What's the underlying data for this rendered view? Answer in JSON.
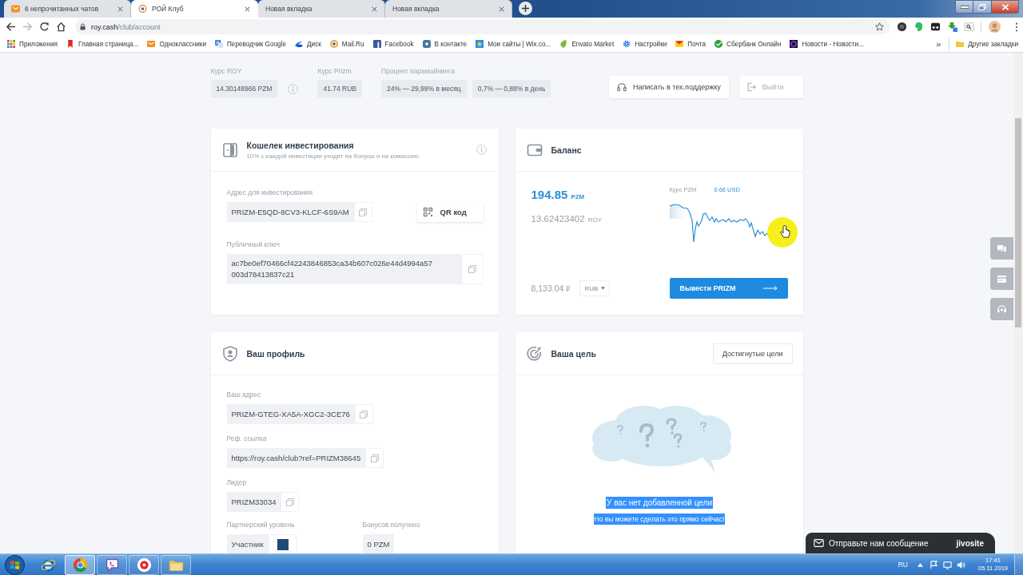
{
  "browser": {
    "tabs": [
      {
        "title": "6 непрочитанных чатов",
        "kind": "mail",
        "selected": false
      },
      {
        "title": "РОЙ Клуб",
        "kind": "site",
        "selected": true
      },
      {
        "title": "Новая вкладка",
        "kind": "blank",
        "selected": false
      },
      {
        "title": "Новая вкладка",
        "kind": "blank",
        "selected": false
      }
    ],
    "address": {
      "host": "roy.cash",
      "path": "/club/account"
    },
    "bookmarks": [
      {
        "label": "Приложения",
        "kind": "apps"
      },
      {
        "label": "Главная страница...",
        "kind": "stroke"
      },
      {
        "label": "Одноклассники",
        "kind": "envelope"
      },
      {
        "label": "Переводчик Google",
        "kind": "translate"
      },
      {
        "label": "Диск",
        "kind": "swoosh"
      },
      {
        "label": "Mail.Ru",
        "kind": "ring"
      },
      {
        "label": "Facebook",
        "kind": "square"
      },
      {
        "label": "В контакте",
        "kind": "rounded"
      },
      {
        "label": "Мои сайты | Wix.co...",
        "kind": "star"
      },
      {
        "label": "Envato Market",
        "kind": "leaf"
      },
      {
        "label": "Настройки",
        "kind": "gear"
      },
      {
        "label": "Почта",
        "kind": "mail"
      },
      {
        "label": "Сбербанк Онлайн",
        "kind": "check"
      },
      {
        "label": "Новости - Новости...",
        "kind": "orb"
      }
    ],
    "more": "»",
    "other_bookmarks": "Другие закладки"
  },
  "rates": [
    {
      "label": "Курс ROY",
      "values": [
        "14.30148966 PZM"
      ],
      "info": true
    },
    {
      "label": "Курс Prizm",
      "values": [
        "41.74 RUB"
      ],
      "info": false
    },
    {
      "label": "Процент парамайнинга",
      "values": [
        "24% — 29,99% в месяц",
        "0,7% — 0,88% в день"
      ],
      "info": false
    }
  ],
  "support_button": "Написать в тех.поддержку",
  "logout_button": "Выйти",
  "wallet": {
    "title": "Кошелек инвестирования",
    "subtitle": "10% с каждой инвестиции уходят на бонусы и на комиссию",
    "address_label": "Адрес для инвестирования",
    "address": "PRIZM-E5QD-8CV3-KLCF-6S9AM",
    "qr_button": "QR код",
    "key_label": "Публичный ключ",
    "public_key": "ac7be0ef70466cf42243846853ca34b607c026e44d4994a57003d78413837c21"
  },
  "balance": {
    "title": "Баланс",
    "pzm_amount": "194.85",
    "pzm_unit": "PZM",
    "roy_amount": "13.62423402",
    "roy_unit": "ROY",
    "rate_label": "Курс PZM",
    "rate_value": "0.66 USD",
    "fiat_amount": "8,133.04",
    "fiat_sign": "₽",
    "currency": "RUB",
    "withdraw_button": "Вывести PRIZM"
  },
  "profile": {
    "title": "Ваш профиль",
    "fields": [
      {
        "label": "Ваш адрес",
        "value": "PRIZM-GTEG-XA5A-XGC2-3CE76"
      },
      {
        "label": "Реф. ссылка",
        "value": "https://roy.cash/club?ref=PRIZM38645"
      },
      {
        "label": "Лидер",
        "value": "PRIZM33034"
      }
    ],
    "status_label": "Партнерский уровень",
    "status": "Участник",
    "bonus_label": "Бонусов получено",
    "bonus": "0 PZM"
  },
  "goal": {
    "title": "Ваша цель",
    "achieved_button": "Достигнутые цели",
    "empty_lines": [
      {
        "kind": "title",
        "text": "У вас нет добавленной цели",
        "selected": true
      },
      {
        "kind": "hint",
        "text": "Но вы можете сделать это прямо сейчас!",
        "selected": true
      }
    ]
  },
  "chat_widget": {
    "label": "Отправьте нам сообщение",
    "brand": "jivosite"
  },
  "taskbar": {
    "apps": [
      {
        "kind": "orbit",
        "running": false,
        "selected": false
      },
      {
        "kind": "tricolor",
        "running": true,
        "selected": true
      },
      {
        "kind": "phone",
        "running": true,
        "selected": false
      },
      {
        "kind": "disc",
        "running": true,
        "selected": false
      },
      {
        "kind": "folder",
        "running": true,
        "selected": false
      }
    ],
    "language": "RU",
    "time": "17:41",
    "date": "05.11.2019"
  }
}
